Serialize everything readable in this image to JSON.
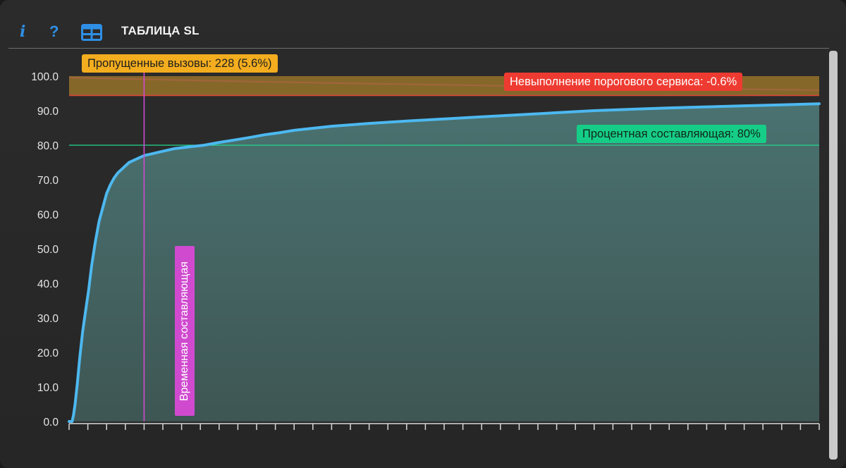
{
  "toolbar": {
    "info_icon": "i",
    "help_icon": "?",
    "table_icon": "table-grid-icon",
    "title": "ТАБЛИЦА SL"
  },
  "chart_data": {
    "type": "area",
    "title": "",
    "xlabel": "",
    "ylabel": "",
    "ylim": [
      0,
      100
    ],
    "yticks": [
      "0.0",
      "10.0",
      "20.0",
      "30.0",
      "40.0",
      "50.0",
      "60.0",
      "70.0",
      "80.0",
      "90.0",
      "100.0"
    ],
    "x_tick_count": 41,
    "grid": false,
    "series": [
      {
        "x": [
          0,
          0.4,
          0.6,
          0.8,
          1.1,
          1.4,
          1.8,
          2.2,
          2.6,
          3.0,
          3.5,
          4.0,
          4.5,
          5.0,
          5.5,
          6.0,
          6.5,
          7.0,
          7.5,
          8.0,
          9.0,
          10.0,
          11,
          12,
          14,
          16,
          18,
          20,
          22,
          24,
          26,
          28,
          30,
          35,
          40,
          45,
          50,
          55,
          60,
          65,
          70,
          75,
          80,
          85,
          90,
          95,
          100
        ],
        "values": [
          0,
          0,
          2,
          5,
          11,
          18,
          26,
          32,
          38,
          45,
          52,
          58,
          62,
          66,
          68.5,
          70.5,
          72,
          73,
          74,
          75,
          76,
          77,
          77.5,
          78,
          79,
          79.5,
          80,
          80.8,
          81.5,
          82.2,
          83,
          83.6,
          84.3,
          85.5,
          86.3,
          87,
          87.6,
          88.2,
          88.8,
          89.4,
          90,
          90.4,
          90.8,
          91.1,
          91.4,
          91.7,
          92
        ]
      }
    ],
    "threshold_band": {
      "y0": 94.4,
      "y1": 100
    },
    "reference_line": {
      "y": 80
    },
    "time_marker": {
      "x": 10.0
    },
    "colors": {
      "curve": "#4db8f0",
      "area": "#4a6b68",
      "band": "#8a6a2a",
      "band_edge": "#e0443a",
      "reference": "#22d98e",
      "marker": "#d04ad0"
    },
    "annotations": {
      "missed_calls": "Пропущенные вызовы: 228 (5.6%)",
      "threshold_violation": "Невыполнение порогового сервиса: -0.6%",
      "percent_component": "Процентная составляющая: 80%",
      "time_component": "Временная составляющая"
    }
  }
}
